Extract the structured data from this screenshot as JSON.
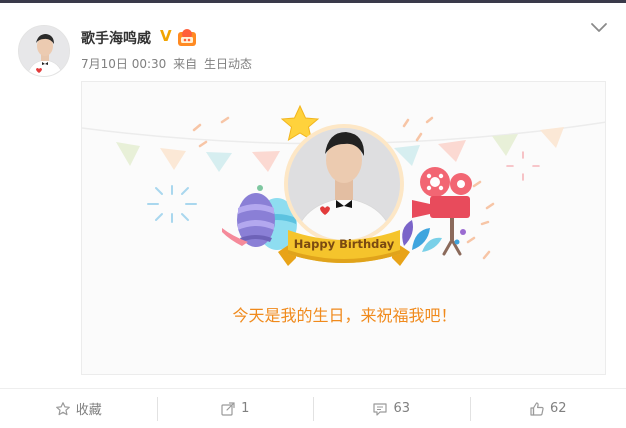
{
  "post": {
    "author_name": "歌手海鸣威",
    "vip_badge": "V",
    "date": "7月10日 00:30",
    "source_prefix": "来自",
    "source": "生日动态"
  },
  "card": {
    "ribbon_text": "Happy Birthday",
    "message": "今天是我的生日，来祝福我吧！"
  },
  "actions": {
    "favorite_label": "收藏",
    "repost_count": "1",
    "comment_count": "63",
    "like_count": "62"
  },
  "colors": {
    "message": "#f08a1c",
    "vip": "#f1a400",
    "ribbon": "#f5c42c",
    "ribbon_text": "#7a4a12"
  }
}
